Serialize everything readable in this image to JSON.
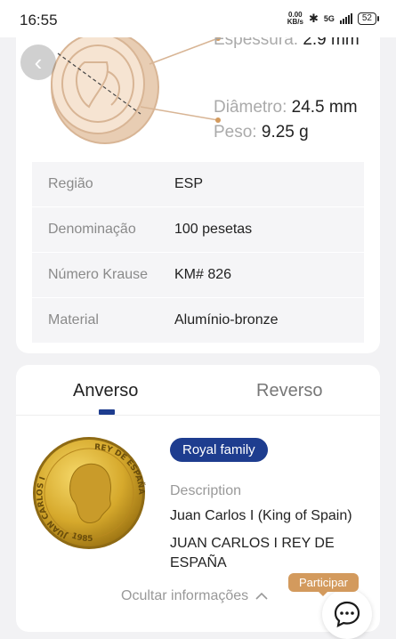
{
  "status_bar": {
    "time": "16:55",
    "net_speed_value": "0.00",
    "net_speed_unit": "KB/s",
    "network": "5G",
    "battery": "52"
  },
  "dimensions": {
    "thickness_label": "Espessura:",
    "thickness_value": "2.9 mm",
    "diameter_label": "Diâmetro:",
    "diameter_value": "24.5 mm",
    "weight_label": "Peso:",
    "weight_value": "9.25 g"
  },
  "info_table": [
    {
      "label": "Região",
      "value": "ESP"
    },
    {
      "label": "Denominação",
      "value": "100 pesetas"
    },
    {
      "label": "Número Krause",
      "value": "KM# 826"
    },
    {
      "label": "Material",
      "value": "Alumínio-bronze"
    }
  ],
  "tabs": {
    "obverse": "Anverso",
    "reverse": "Reverso",
    "active": "obverse"
  },
  "obverse": {
    "badge": "Royal family",
    "description_label": "Description",
    "description": "Juan Carlos I (King of Spain)",
    "inscription": "JUAN CARLOS I REY DE ESPAÑA"
  },
  "coin_legend": {
    "left": "JUAN CARLOS I",
    "right": "REY DE ESPAÑA",
    "year": "1985"
  },
  "actions": {
    "hide_info": "Ocultar informações",
    "join": "Participar"
  },
  "colors": {
    "accent": "#1e3d8f",
    "coin_diagram": "#e3c3a5",
    "join_badge": "#d39a5d"
  }
}
